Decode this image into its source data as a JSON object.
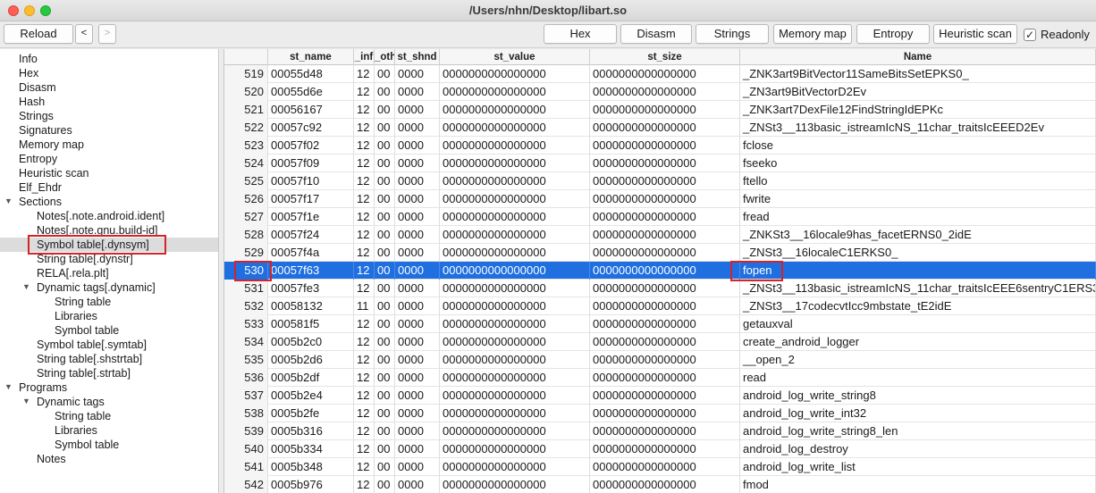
{
  "window": {
    "title": "/Users/nhn/Desktop/libart.so"
  },
  "toolbar": {
    "reload": "Reload",
    "back": "<",
    "forward": ">",
    "tabs": [
      "Hex",
      "Disasm",
      "Strings",
      "Memory map",
      "Entropy",
      "Heuristic scan"
    ],
    "readonly_label": "Readonly",
    "readonly_checked": "✓"
  },
  "sidebar": {
    "items": [
      {
        "label": "Info",
        "indent": 0
      },
      {
        "label": "Hex",
        "indent": 0
      },
      {
        "label": "Disasm",
        "indent": 0
      },
      {
        "label": "Hash",
        "indent": 0
      },
      {
        "label": "Strings",
        "indent": 0
      },
      {
        "label": "Signatures",
        "indent": 0
      },
      {
        "label": "Memory map",
        "indent": 0
      },
      {
        "label": "Entropy",
        "indent": 0
      },
      {
        "label": "Heuristic scan",
        "indent": 0
      },
      {
        "label": "Elf_Ehdr",
        "indent": 0
      },
      {
        "label": "Sections",
        "indent": 0,
        "expanded": true
      },
      {
        "label": "Notes[.note.android.ident]",
        "indent": 1
      },
      {
        "label": "Notes[.note.gnu.build-id]",
        "indent": 1
      },
      {
        "label": "Symbol table[.dynsym]",
        "indent": 1,
        "selected": true
      },
      {
        "label": "String table[.dynstr]",
        "indent": 1
      },
      {
        "label": "RELA[.rela.plt]",
        "indent": 1
      },
      {
        "label": "Dynamic tags[.dynamic]",
        "indent": 1,
        "expanded": true
      },
      {
        "label": "String table",
        "indent": 2
      },
      {
        "label": "Libraries",
        "indent": 2
      },
      {
        "label": "Symbol table",
        "indent": 2
      },
      {
        "label": "Symbol table[.symtab]",
        "indent": 1
      },
      {
        "label": "String table[.shstrtab]",
        "indent": 1
      },
      {
        "label": "String table[.strtab]",
        "indent": 1
      },
      {
        "label": "Programs",
        "indent": 0,
        "expanded": true
      },
      {
        "label": "Dynamic tags",
        "indent": 1,
        "expanded": true
      },
      {
        "label": "String table",
        "indent": 2
      },
      {
        "label": "Libraries",
        "indent": 2
      },
      {
        "label": "Symbol table",
        "indent": 2
      },
      {
        "label": "Notes",
        "indent": 1
      }
    ]
  },
  "table": {
    "columns": [
      "",
      "st_name",
      "_inf",
      "_oth",
      "st_shnd",
      "st_value",
      "st_size",
      "Name"
    ],
    "selected_row": "530",
    "rows": [
      [
        "519",
        "00055d48",
        "12",
        "00",
        "0000",
        "0000000000000000",
        "0000000000000000",
        "_ZNK3art9BitVector11SameBitsSetEPKS0_"
      ],
      [
        "520",
        "00055d6e",
        "12",
        "00",
        "0000",
        "0000000000000000",
        "0000000000000000",
        "_ZN3art9BitVectorD2Ev"
      ],
      [
        "521",
        "00056167",
        "12",
        "00",
        "0000",
        "0000000000000000",
        "0000000000000000",
        "_ZNK3art7DexFile12FindStringIdEPKc"
      ],
      [
        "522",
        "00057c92",
        "12",
        "00",
        "0000",
        "0000000000000000",
        "0000000000000000",
        "_ZNSt3__113basic_istreamIcNS_11char_traitsIcEEED2Ev"
      ],
      [
        "523",
        "00057f02",
        "12",
        "00",
        "0000",
        "0000000000000000",
        "0000000000000000",
        "fclose"
      ],
      [
        "524",
        "00057f09",
        "12",
        "00",
        "0000",
        "0000000000000000",
        "0000000000000000",
        "fseeko"
      ],
      [
        "525",
        "00057f10",
        "12",
        "00",
        "0000",
        "0000000000000000",
        "0000000000000000",
        "ftello"
      ],
      [
        "526",
        "00057f17",
        "12",
        "00",
        "0000",
        "0000000000000000",
        "0000000000000000",
        "fwrite"
      ],
      [
        "527",
        "00057f1e",
        "12",
        "00",
        "0000",
        "0000000000000000",
        "0000000000000000",
        "fread"
      ],
      [
        "528",
        "00057f24",
        "12",
        "00",
        "0000",
        "0000000000000000",
        "0000000000000000",
        "_ZNKSt3__16locale9has_facetERNS0_2idE"
      ],
      [
        "529",
        "00057f4a",
        "12",
        "00",
        "0000",
        "0000000000000000",
        "0000000000000000",
        "_ZNSt3__16localeC1ERKS0_"
      ],
      [
        "530",
        "00057f63",
        "12",
        "00",
        "0000",
        "0000000000000000",
        "0000000000000000",
        "fopen"
      ],
      [
        "531",
        "00057fe3",
        "12",
        "00",
        "0000",
        "0000000000000000",
        "0000000000000000",
        "_ZNSt3__113basic_istreamIcNS_11char_traitsIcEEE6sentryC1ERS3_b"
      ],
      [
        "532",
        "00058132",
        "11",
        "00",
        "0000",
        "0000000000000000",
        "0000000000000000",
        "_ZNSt3__17codecvtIcc9mbstate_tE2idE"
      ],
      [
        "533",
        "000581f5",
        "12",
        "00",
        "0000",
        "0000000000000000",
        "0000000000000000",
        "getauxval"
      ],
      [
        "534",
        "0005b2c0",
        "12",
        "00",
        "0000",
        "0000000000000000",
        "0000000000000000",
        "create_android_logger"
      ],
      [
        "535",
        "0005b2d6",
        "12",
        "00",
        "0000",
        "0000000000000000",
        "0000000000000000",
        "__open_2"
      ],
      [
        "536",
        "0005b2df",
        "12",
        "00",
        "0000",
        "0000000000000000",
        "0000000000000000",
        "read"
      ],
      [
        "537",
        "0005b2e4",
        "12",
        "00",
        "0000",
        "0000000000000000",
        "0000000000000000",
        "android_log_write_string8"
      ],
      [
        "538",
        "0005b2fe",
        "12",
        "00",
        "0000",
        "0000000000000000",
        "0000000000000000",
        "android_log_write_int32"
      ],
      [
        "539",
        "0005b316",
        "12",
        "00",
        "0000",
        "0000000000000000",
        "0000000000000000",
        "android_log_write_string8_len"
      ],
      [
        "540",
        "0005b334",
        "12",
        "00",
        "0000",
        "0000000000000000",
        "0000000000000000",
        "android_log_destroy"
      ],
      [
        "541",
        "0005b348",
        "12",
        "00",
        "0000",
        "0000000000000000",
        "0000000000000000",
        "android_log_write_list"
      ],
      [
        "542",
        "0005b976",
        "12",
        "00",
        "0000",
        "0000000000000000",
        "0000000000000000",
        "fmod"
      ]
    ]
  },
  "colors": {
    "selection": "#1f6fe0",
    "highlight_box": "#d4232a"
  }
}
